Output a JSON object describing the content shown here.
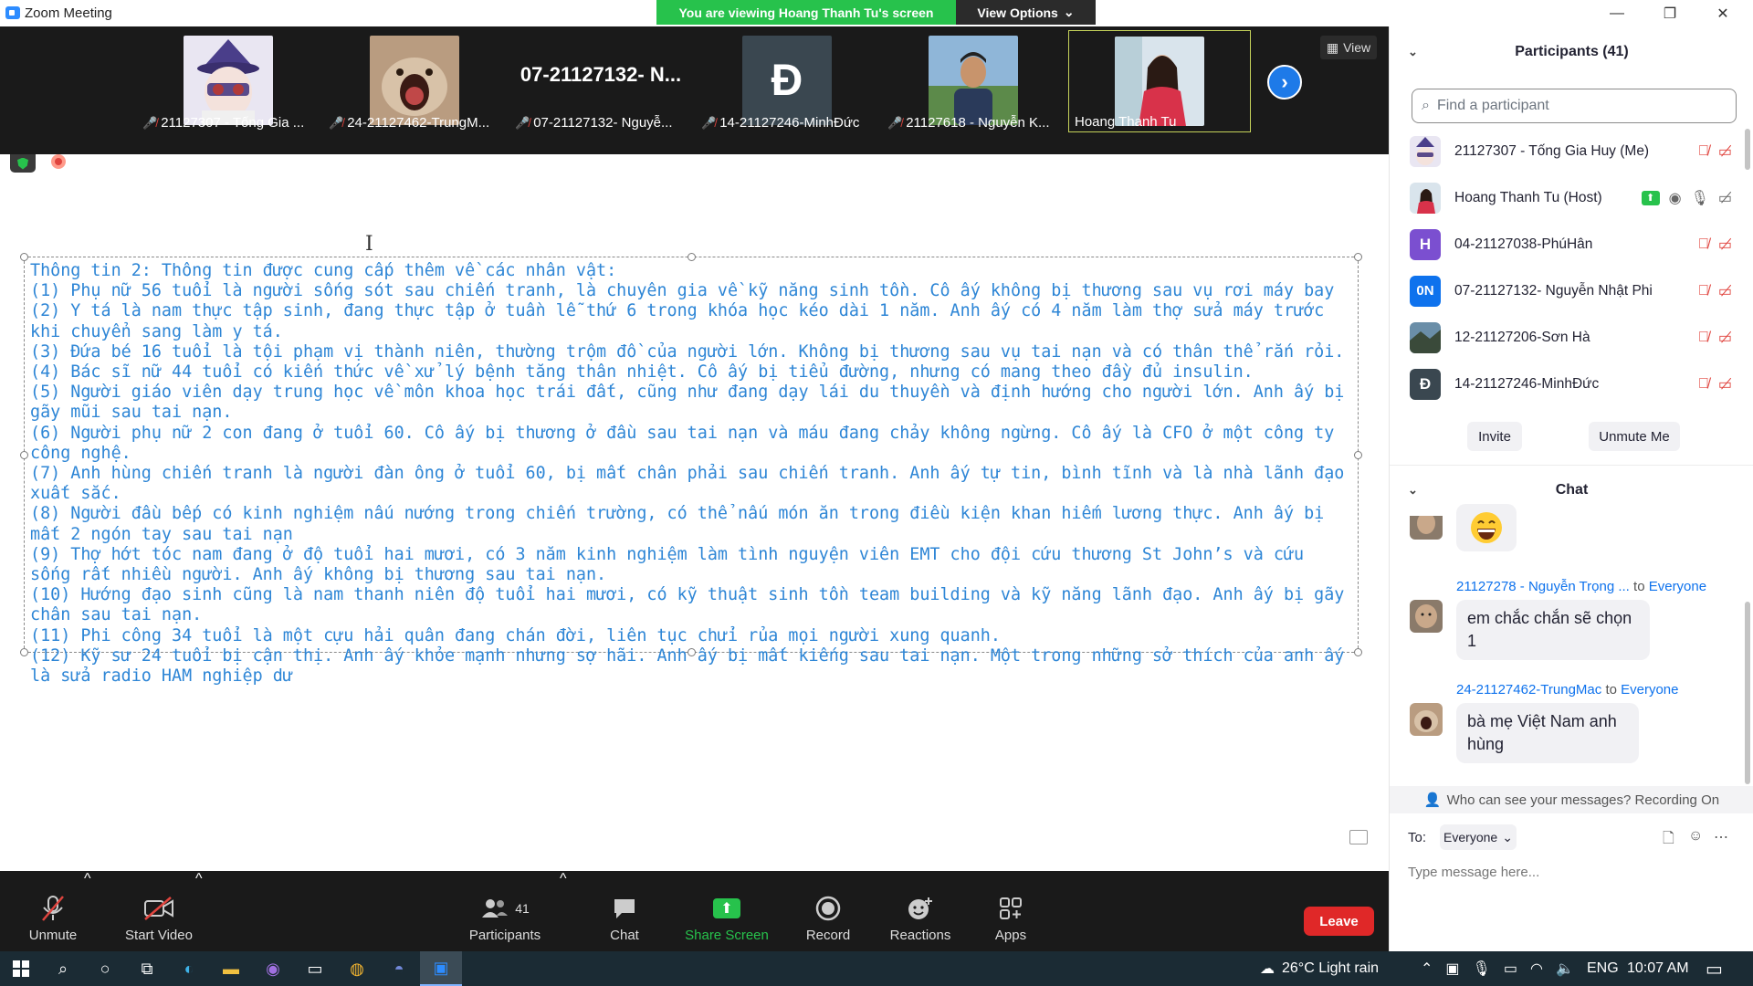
{
  "window": {
    "title": "Zoom Meeting",
    "viewing_banner": "You are viewing Hoang Thanh Tu's screen",
    "view_options": "View Options"
  },
  "gallery": {
    "tiles": [
      {
        "name": "21127307 - Tống Gia ...",
        "muted": true
      },
      {
        "name": "24-21127462-TrungM...",
        "muted": true
      },
      {
        "name": "07-21127132- Nguyễ...",
        "muted": true,
        "big_text": "07-21127132- N..."
      },
      {
        "name": "14-21127246-MinhĐức",
        "muted": true,
        "initial": "Đ"
      },
      {
        "name": "21127618 - Nguyễn K...",
        "muted": true
      },
      {
        "name": "Hoang Thanh Tu",
        "muted": false
      }
    ],
    "view_label": "View"
  },
  "document": {
    "lines": [
      "Thông tin 2: Thông tin được cung cấp thêm về các nhân vật:",
      "(1) Phụ nữ 56 tuổi là người sống sót sau chiến tranh, là chuyên gia về kỹ năng sinh tồn. Cô ấy không bị thương sau vụ rơi máy bay",
      "(2) Y tá là nam thực tập sinh, đang thực tập ở tuần lễ thứ 6 trong khóa học kéo dài 1 năm. Anh ấy có 4 năm làm thợ sửa máy trước khi chuyển sang làm y tá.",
      "(3) Đứa bé 16 tuổi là tội phạm vị thành niên, thường trộm đồ của người lớn. Không bị thương sau vụ tai nạn và có thân thể rắn rỏi.",
      "(4) Bác sĩ nữ 44 tuổi có kiến thức về xử lý bệnh tăng thân nhiệt. Cô ấy bị tiểu đường, nhưng có mang theo đầy đủ insulin.",
      "(5) Người giáo viên dạy trung học về môn khoa học trái đất, cũng như đang dạy lái du thuyền và định hướng cho người lớn. Anh ấy bị gãy mũi sau tai nạn.",
      "(6) Người phụ nữ 2 con đang ở tuổi 60. Cô ấy bị thương ở đầu sau tai nạn và máu đang chảy không ngừng. Cô ấy là CFO ở một công ty công nghệ.",
      "(7) Anh hùng chiến tranh là người đàn ông ở tuổi 60, bị mất chân phải sau chiến tranh. Anh ấy tự tin, bình tĩnh và là nhà lãnh đạo xuất sắc.",
      "(8) Người đầu bếp có kinh nghiệm nấu nướng trong chiến trường, có thể nấu món ăn trong điều kiện khan hiếm lương thực. Anh ấy bị mất 2 ngón tay sau tai nạn",
      "(9) Thợ hớt tóc nam đang ở độ tuổi hai mươi, có 3 năm kinh nghiệm làm tình nguyện viên EMT cho đội cứu thương St John’s và cứu sống rất nhiều người. Anh ấy không bị thương sau tai nạn.",
      "(10) Hướng đạo sinh cũng là nam thanh niên độ tuổi hai mươi, có kỹ thuật sinh tồn team building và kỹ năng lãnh đạo. Anh ấy bị gãy chân sau tai nạn.",
      "(11) Phi công 34 tuổi là một cựu hải quân đang chán đời, liên tục chửi rủa mọi người xung quanh.",
      "(12) Kỹ sư 24 tuổi bị cận thị. Anh ấy khỏe mạnh nhưng sợ hãi. Anh ấy bị mất kiếng sau tai nạn. Một trong những sở thích của anh ấy là sửa radio HAM nghiệp dư"
    ]
  },
  "controls": {
    "unmute": "Unmute",
    "start_video": "Start Video",
    "participants": "Participants",
    "participants_count": "41",
    "chat": "Chat",
    "share_screen": "Share Screen",
    "record": "Record",
    "reactions": "Reactions",
    "apps": "Apps",
    "leave": "Leave"
  },
  "participants_panel": {
    "header": "Participants (41)",
    "search_placeholder": "Find a participant",
    "rows": [
      {
        "name": "21127307 - Tống Gia Huy (Me)",
        "avatar": "anime"
      },
      {
        "name": "Hoang Thanh Tu (Host)",
        "avatar": "photo"
      },
      {
        "name": "04-21127038-PhúHân",
        "avatar": "H",
        "color": "#7b4fd0"
      },
      {
        "name": "07-21127132- Nguyễn Nhật Phi",
        "avatar": "0N",
        "color": "#0e72ed"
      },
      {
        "name": "12-21127206-Sơn Hà",
        "avatar": "photo2"
      },
      {
        "name": "14-21127246-MinhĐức",
        "avatar": "Đ",
        "color": "#3a4750"
      }
    ],
    "invite": "Invite",
    "unmute_me": "Unmute Me"
  },
  "chat_panel": {
    "header": "Chat",
    "messages": [
      {
        "sender": "21127278 - Nguyễn Trọng ...",
        "to": "to",
        "recipient": "Everyone",
        "text": "em chắc chắn sẽ chọn 1"
      },
      {
        "sender": "24-21127462-TrungMac",
        "to": "to",
        "recipient": "Everyone",
        "text": "bà mẹ Việt Nam anh hùng"
      }
    ],
    "who_can_see": "Who can see your messages? Recording On",
    "to_label": "To:",
    "to_value": "Everyone",
    "input_placeholder": "Type message here..."
  },
  "taskbar": {
    "weather": "26°C  Light rain",
    "lang": "ENG",
    "time": "10:07 AM"
  }
}
